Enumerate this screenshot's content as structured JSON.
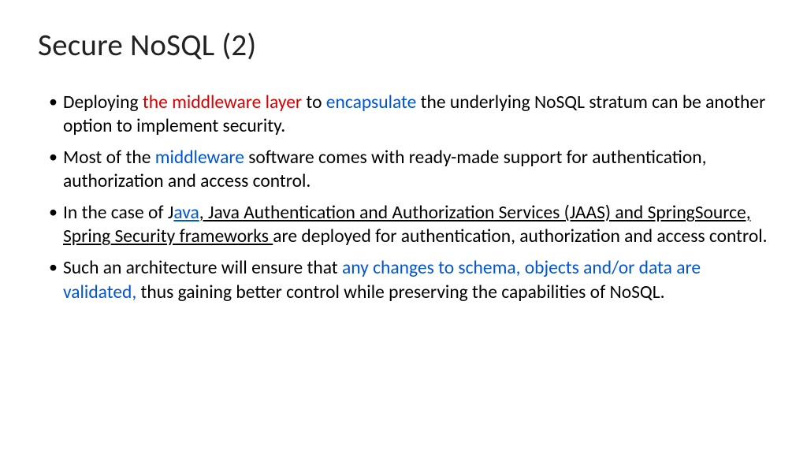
{
  "title": "Secure NoSQL (2)",
  "b1": {
    "t1": "Deploying ",
    "t2": "the middleware layer ",
    "t3": "to ",
    "t4": "encapsulate ",
    "t5": "the underlying NoSQL stratum can be another option to implement security."
  },
  "b2": {
    "t1": "Most of the ",
    "t2": "middleware ",
    "t3": "software comes with ready-made support for authentication, authorization and access control."
  },
  "b3": {
    "t1": "In the case of J",
    "t2": "ava",
    "t3": ", Java Authentication and Authorization Services (JAAS) and SpringSource, Spring Security frameworks ",
    "t4": "are deployed for authentication, authorization and access control."
  },
  "b4": {
    "t1": "Such an architecture will ensure that ",
    "t2": "any changes to schema, objects and/or data are validated, ",
    "t3": "thus gaining better control while preserving the capabilities of NoSQL."
  }
}
